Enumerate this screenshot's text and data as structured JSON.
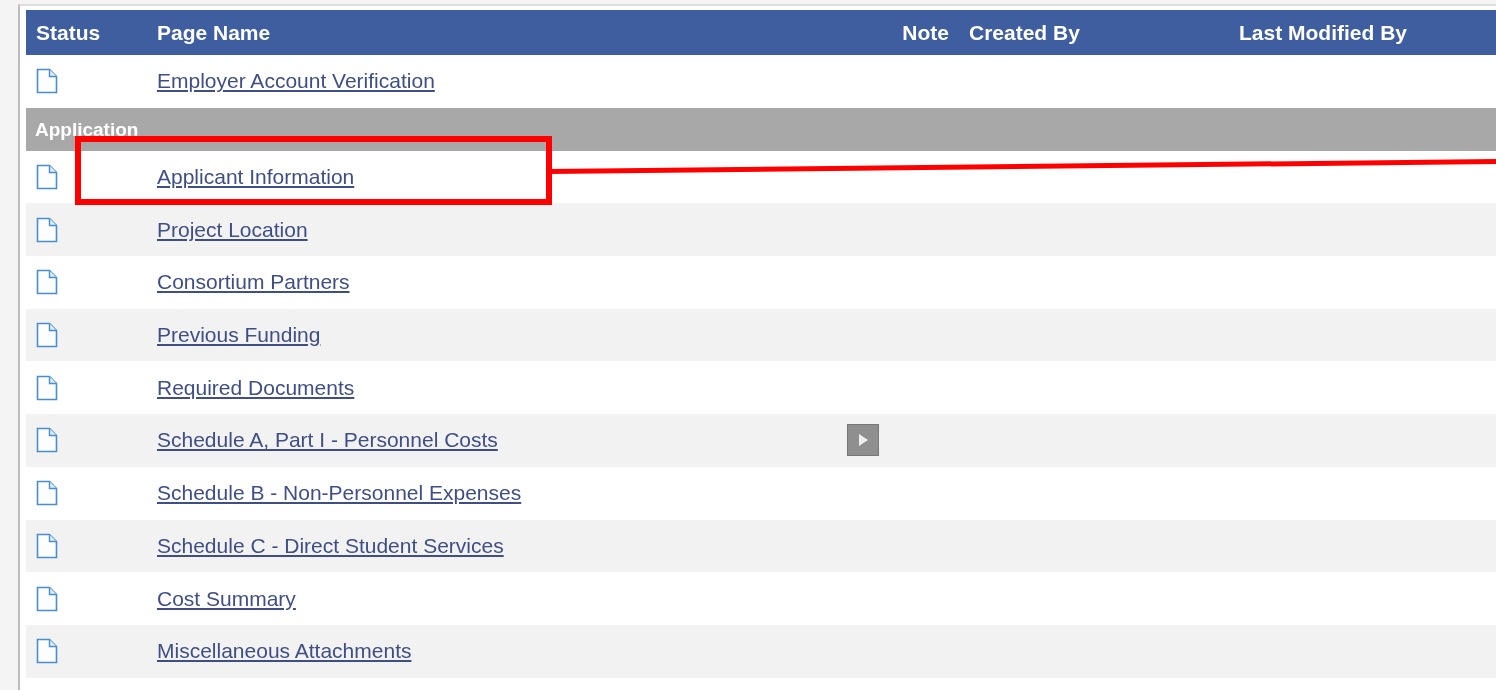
{
  "table": {
    "columns": [
      "Status",
      "Page Name",
      "Note",
      "Created By",
      "Last Modified By"
    ],
    "rows": [
      {
        "kind": "page",
        "name": "Employer Account Verification",
        "has_note": false
      },
      {
        "kind": "section",
        "name": "Application"
      },
      {
        "kind": "page",
        "name": "Applicant Information",
        "has_note": false
      },
      {
        "kind": "page",
        "name": "Project Location",
        "has_note": false
      },
      {
        "kind": "page",
        "name": "Consortium Partners",
        "has_note": false
      },
      {
        "kind": "page",
        "name": "Previous Funding",
        "has_note": false
      },
      {
        "kind": "page",
        "name": "Required Documents",
        "has_note": false
      },
      {
        "kind": "page",
        "name": "Schedule A, Part I - Personnel Costs",
        "has_note": true
      },
      {
        "kind": "page",
        "name": "Schedule B - Non-Personnel Expenses",
        "has_note": false
      },
      {
        "kind": "page",
        "name": "Schedule C - Direct Student Services",
        "has_note": false
      },
      {
        "kind": "page",
        "name": "Cost Summary",
        "has_note": false
      },
      {
        "kind": "page",
        "name": "Miscellaneous Attachments",
        "has_note": false
      }
    ]
  }
}
